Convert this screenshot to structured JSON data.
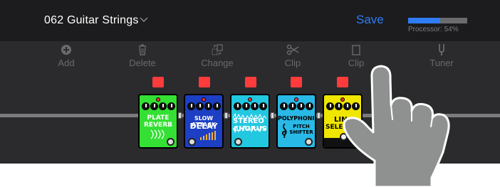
{
  "header": {
    "preset_name": "062 Guitar Strings",
    "save_label": "Save",
    "processor_label": "Processor: 54%",
    "processor_percent": 54
  },
  "toolbar": {
    "add_label": "Add",
    "delete_label": "Delete",
    "change_label": "Change",
    "clip_label": "Clip",
    "clip2_label": "Clip",
    "tuner_label": "Tuner"
  },
  "pedals": [
    {
      "name_line1": "PLATE",
      "name_line2": "REVERB",
      "color": "#34e034"
    },
    {
      "name_line1": "SLOW ATTACK",
      "name_line2": "DELAY",
      "color": "#1d3fc4"
    },
    {
      "name_line1": "STEREO",
      "name_line2": "CHORUS",
      "color": "#22c8e0"
    },
    {
      "name_line1": "POLYPHONIC",
      "name_line2": "PITCH SHIFTER",
      "color": "#29b9e6"
    },
    {
      "name_line1": "LIN",
      "name_line2": "SELEC",
      "color": "#f0e600"
    }
  ],
  "colors": {
    "accent": "#2f7cf6",
    "bypass_toggle": "#ff3b3b"
  }
}
